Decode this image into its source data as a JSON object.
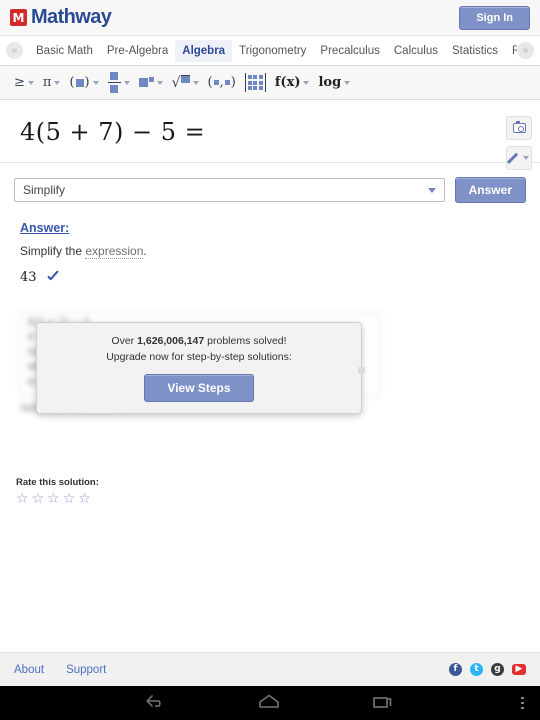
{
  "header": {
    "logo_mark": "M",
    "logo_text": "Mathway",
    "signin_label": "Sign In"
  },
  "tabbar": {
    "scroll_left_icon": "«",
    "scroll_right_icon": "»",
    "tabs": [
      {
        "label": "Basic Math",
        "active": false
      },
      {
        "label": "Pre-Algebra",
        "active": false
      },
      {
        "label": "Algebra",
        "active": true
      },
      {
        "label": "Trigonometry",
        "active": false
      },
      {
        "label": "Precalculus",
        "active": false
      },
      {
        "label": "Calculus",
        "active": false
      },
      {
        "label": "Statistics",
        "active": false
      },
      {
        "label": "Finit",
        "active": false
      }
    ]
  },
  "mathbar": {
    "items": [
      {
        "name": "inequality",
        "glyph": "≥",
        "caret": true
      },
      {
        "name": "pi",
        "glyph": "π",
        "caret": true
      },
      {
        "name": "parentheses",
        "glyph": "(■)",
        "caret": true
      },
      {
        "name": "fraction",
        "glyph": "fraction",
        "caret": true
      },
      {
        "name": "exponent",
        "glyph": "■▪",
        "caret": true
      },
      {
        "name": "square-root",
        "glyph": "√■",
        "caret": true
      },
      {
        "name": "coordinate-pair",
        "glyph": "(▪,▪)",
        "caret": false
      },
      {
        "name": "matrix",
        "glyph": "matrix",
        "caret": false
      },
      {
        "name": "function",
        "glyph": "f(x)",
        "caret": true
      },
      {
        "name": "logarithm",
        "glyph": "log",
        "caret": true
      }
    ]
  },
  "problem": {
    "expression": "4(5 + 7) − 5 ="
  },
  "side_tools": {
    "camera_icon": "camera-icon",
    "pencil_icon": "pencil-icon"
  },
  "operation": {
    "selected": "Simplify",
    "answer_label": "Answer"
  },
  "answer": {
    "title": "Answer:",
    "instruction_prefix": "Simplify the ",
    "instruction_link": "expression",
    "instruction_suffix": ".",
    "value": "43",
    "check_icon": "checkmark-icon"
  },
  "steps_blurred": {
    "line1": "4(5 + 7) − 5",
    "line2": "4 · 12 − 5",
    "label": "Simplify",
    "line3": "48 − 5",
    "line4": "43",
    "line5": "Add 1 to −6 to get −5."
  },
  "modal": {
    "text_prefix": "Over ",
    "problems_solved": "1,626,006,147",
    "text_suffix": " problems solved!",
    "upgrade_line": "Upgrade now for step-by-step solutions:",
    "button_label": "View Steps"
  },
  "rating": {
    "label": "Rate this solution:",
    "stars": [
      "☆",
      "☆",
      "☆",
      "☆",
      "☆"
    ],
    "filled_count": 0
  },
  "footer": {
    "about_label": "About",
    "support_label": "Support",
    "social": [
      {
        "name": "facebook-icon",
        "glyph": "f",
        "color": "#3b5998"
      },
      {
        "name": "twitter-icon",
        "glyph": "t",
        "color": "#29b6f6"
      },
      {
        "name": "google-plus-icon",
        "glyph": "g",
        "color": "#3d3d3d"
      },
      {
        "name": "youtube-icon",
        "glyph": "▶",
        "color": "#e02f2f"
      }
    ]
  },
  "navbar": {
    "back_icon": "back-arrow-icon",
    "home_icon": "home-icon",
    "recents_icon": "recent-apps-icon",
    "overflow_icon": "overflow-menu-icon"
  },
  "colors": {
    "brand_blue": "#2b4a96",
    "accent_button": "#7e92c8",
    "logo_red": "#d32a2a",
    "link_blue": "#4a6fc0"
  }
}
